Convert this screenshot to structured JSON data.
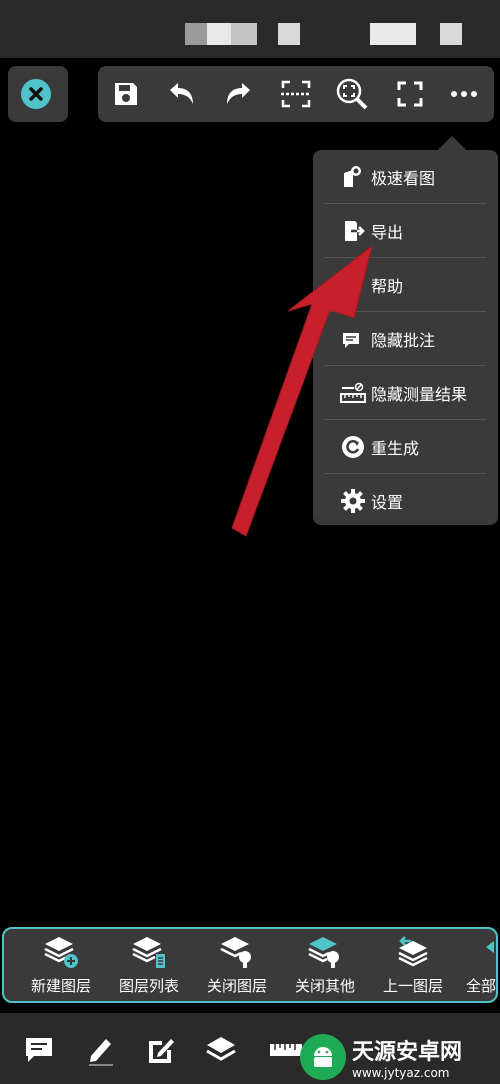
{
  "toolbar": {
    "icons": [
      "close-icon",
      "save-icon",
      "undo-icon",
      "redo-icon",
      "crop-icon",
      "zoom-fit-icon",
      "fullscreen-icon",
      "more-icon"
    ]
  },
  "menu": {
    "items": [
      {
        "label": "极速看图",
        "icon": "quick-view-icon"
      },
      {
        "label": "导出",
        "icon": "export-icon"
      },
      {
        "label": "帮助",
        "icon": "help-icon"
      },
      {
        "label": "隐藏批注",
        "icon": "hide-annotation-icon"
      },
      {
        "label": "隐藏测量结果",
        "icon": "hide-measure-icon"
      },
      {
        "label": "重生成",
        "icon": "regenerate-icon"
      },
      {
        "label": "设置",
        "icon": "settings-icon"
      }
    ]
  },
  "layerbar": {
    "items": [
      {
        "label": "新建图层"
      },
      {
        "label": "图层列表"
      },
      {
        "label": "关闭图层"
      },
      {
        "label": "关闭其他"
      },
      {
        "label": "上一图层"
      },
      {
        "label": "全部"
      }
    ]
  },
  "bottombar": {
    "icons": [
      "comment-icon",
      "pencil-icon",
      "edit-icon",
      "layers-icon",
      "ruler-icon"
    ]
  },
  "watermark": {
    "title": "天源安卓网",
    "url": "www.jytyaz.com"
  },
  "colors": {
    "accent": "#4fc3c9",
    "arrow": "#c8202a",
    "panel": "#3a3a3a"
  }
}
